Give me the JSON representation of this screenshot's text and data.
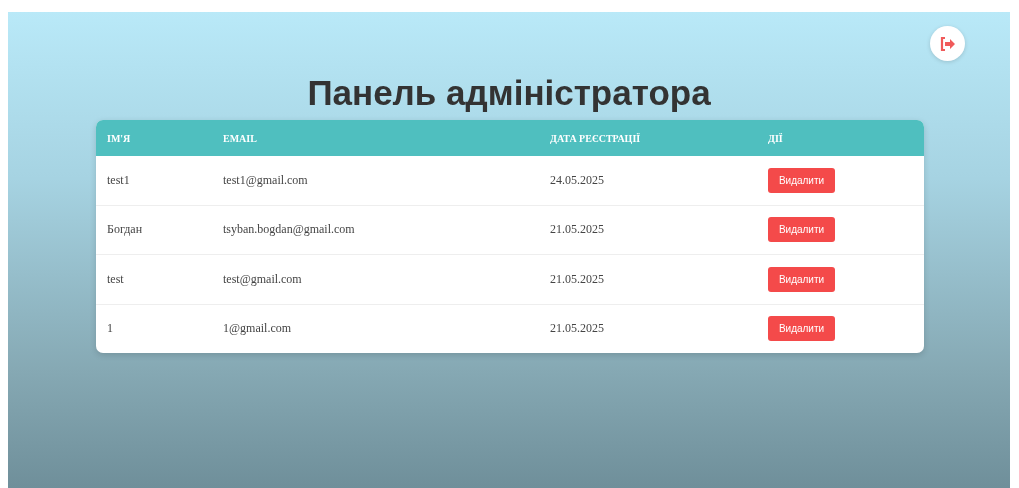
{
  "title": "Панель адміністратора",
  "table": {
    "columns": [
      "ІМ'Я",
      "EMAIL",
      "ДАТА РЕЄСТРАЦІЇ",
      "ДІЇ"
    ],
    "rows": [
      {
        "name": "test1",
        "email": "test1@gmail.com",
        "date": "24.05.2025",
        "action": "Видалити"
      },
      {
        "name": "Богдан",
        "email": "tsyban.bogdan@gmail.com",
        "date": "21.05.2025",
        "action": "Видалити"
      },
      {
        "name": "test",
        "email": "test@gmail.com",
        "date": "21.05.2025",
        "action": "Видалити"
      },
      {
        "name": "1",
        "email": "1@gmail.com",
        "date": "21.05.2025",
        "action": "Видалити"
      }
    ]
  }
}
